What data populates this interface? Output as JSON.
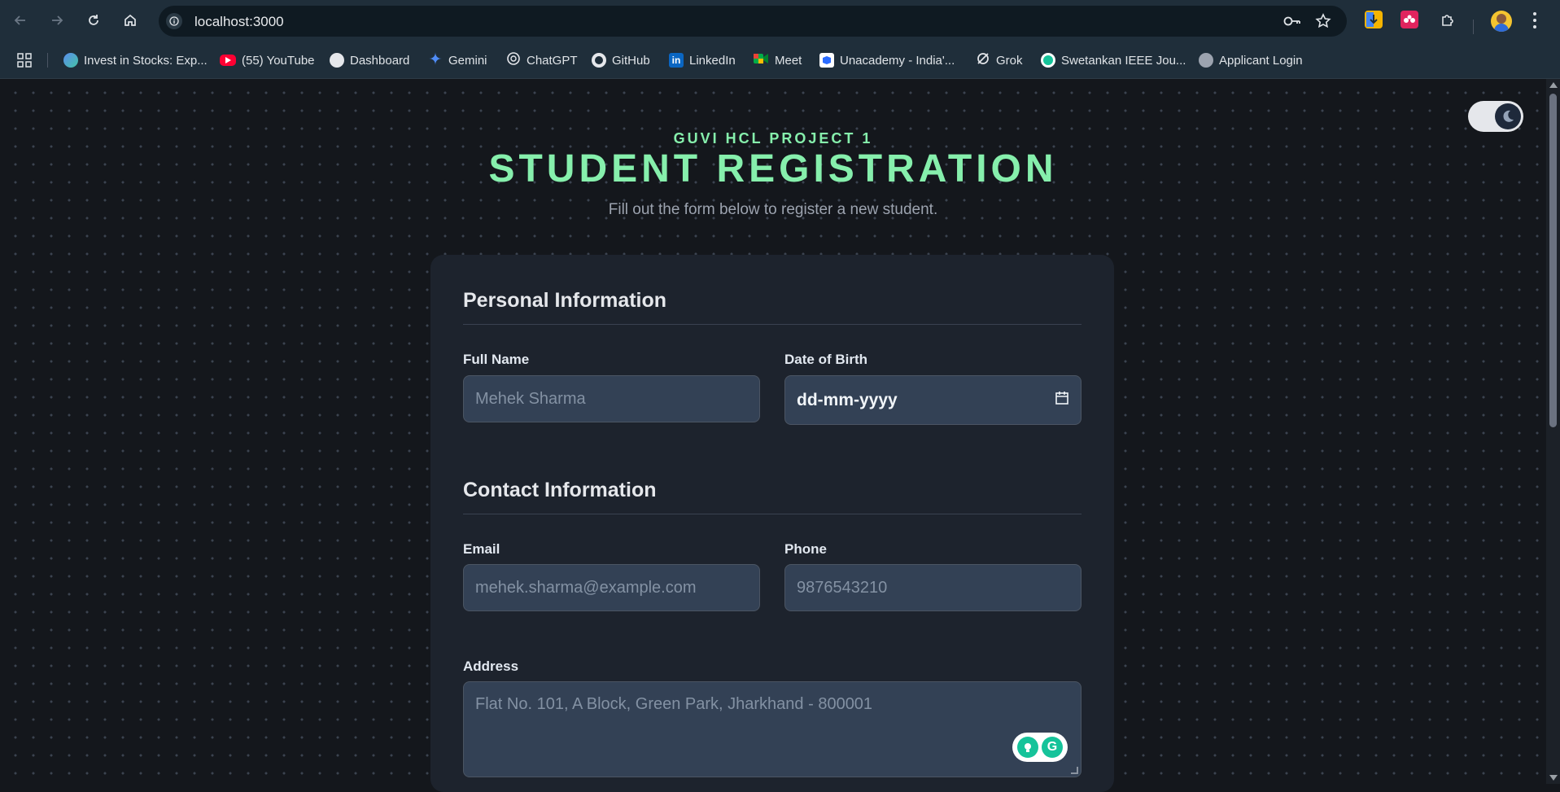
{
  "browser": {
    "url": "localhost:3000",
    "bookmarks": [
      {
        "label": "Invest in Stocks: Exp...",
        "icon": "groww-icon",
        "color": "#5b8def"
      },
      {
        "label": "(55) YouTube",
        "icon": "youtube-icon",
        "color": "#ff0033"
      },
      {
        "label": "Dashboard",
        "icon": "dashboard-icon",
        "color": "#e5e7eb"
      },
      {
        "label": "Gemini",
        "icon": "gemini-icon",
        "color": "#4f8cf7"
      },
      {
        "label": "ChatGPT",
        "icon": "chatgpt-icon",
        "color": "#e5e7eb"
      },
      {
        "label": "GitHub",
        "icon": "github-icon",
        "color": "#e5e7eb"
      },
      {
        "label": "LinkedIn",
        "icon": "linkedin-icon",
        "color": "#0a66c2"
      },
      {
        "label": "Meet",
        "icon": "meet-icon",
        "color": "#00ac47"
      },
      {
        "label": "Unacademy - India'...",
        "icon": "unacademy-icon",
        "color": "#08bd80"
      },
      {
        "label": "Grok",
        "icon": "grok-icon",
        "color": "#e5e7eb"
      },
      {
        "label": "Swetankan IEEE Jou...",
        "icon": "grammarly-icon",
        "color": "#15c39a"
      },
      {
        "label": "Applicant Login",
        "icon": "globe-icon",
        "color": "#9ca3af"
      }
    ]
  },
  "header": {
    "kicker": "GUVI HCL PROJECT 1",
    "title": "STUDENT REGISTRATION",
    "subtitle": "Fill out the form below to register a new student."
  },
  "personal": {
    "title": "Personal Information",
    "full_name_label": "Full Name",
    "full_name_placeholder": "Mehek Sharma",
    "dob_label": "Date of Birth",
    "dob_value": "dd-mm-yyyy"
  },
  "contact": {
    "title": "Contact Information",
    "email_label": "Email",
    "email_placeholder": "mehek.sharma@example.com",
    "phone_label": "Phone",
    "phone_placeholder": "9876543210",
    "address_label": "Address",
    "address_placeholder": "Flat No. 101, A Block, Green Park, Jharkhand - 800001"
  },
  "theme": {
    "accent": "#86efac",
    "background": "#14171c",
    "card": "#1d232d",
    "input": "#334155"
  }
}
